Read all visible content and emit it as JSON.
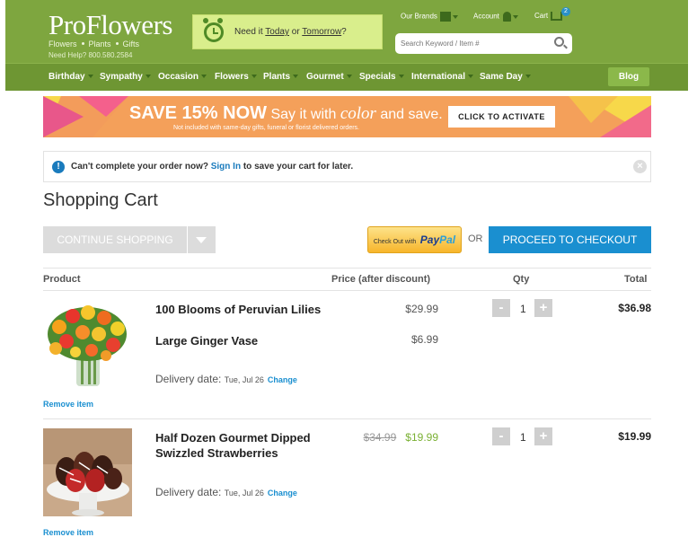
{
  "header": {
    "logo": "ProFlowers",
    "tagline": [
      "Flowers",
      "Plants",
      "Gifts"
    ],
    "help": "Need Help? 800.580.2584",
    "delivery_prefix": "Need it ",
    "delivery_today": "Today",
    "delivery_or": " or ",
    "delivery_tomorrow": "Tomorrow",
    "delivery_suffix": "?",
    "links": {
      "brands": "Our Brands",
      "account": "Account",
      "cart": "Cart"
    },
    "cart_count": "2",
    "search_placeholder": "Search Keyword / Item #"
  },
  "nav": {
    "items": [
      "Birthday",
      "Sympathy",
      "Occasion",
      "Flowers",
      "Plants",
      "Gourmet",
      "Specials",
      "International",
      "Same Day"
    ],
    "blog": "Blog"
  },
  "banner": {
    "headline": "SAVE 15% NOW",
    "say_prefix": "Say it with ",
    "say_color": "color",
    "say_suffix": " and save.",
    "subtext": "Not included with same-day gifts, funeral or florist delivered orders.",
    "cta": "CLICK TO ACTIVATE"
  },
  "notice": {
    "text_before": "Can't complete your order now? ",
    "link": "Sign In",
    "text_after": " to save your cart for later."
  },
  "page_title": "Shopping Cart",
  "actions": {
    "continue": "CONTINUE SHOPPING",
    "paypal_small": "Check Out with",
    "paypal_pay": "Pay",
    "paypal_pal": "Pal",
    "or": "OR",
    "checkout": "PROCEED TO CHECKOUT"
  },
  "table": {
    "headers": {
      "product": "Product",
      "price": "Price (after discount)",
      "qty": "Qty",
      "total": "Total"
    },
    "delivery_label": "Delivery date:",
    "change": "Change",
    "remove": "Remove item",
    "items": [
      {
        "name": "100 Blooms of Peruvian Lilies",
        "price": "$29.99",
        "addon_name": "Large Ginger Vase",
        "addon_price": "$6.99",
        "delivery_date": "Tue, Jul 26",
        "qty": "1",
        "total": "$36.98"
      },
      {
        "name": "Half Dozen Gourmet Dipped Swizzled Strawberries",
        "price_old": "$34.99",
        "price_new": "$19.99",
        "delivery_date": "Tue, Jul 26",
        "qty": "1",
        "total": "$19.99"
      }
    ]
  },
  "colors": {
    "header_green": "#7ea63f",
    "nav_green": "#6e9633",
    "checkout_blue": "#1a8fd0",
    "banner_orange": "#f4a05a",
    "sale_green": "#7ab033"
  }
}
